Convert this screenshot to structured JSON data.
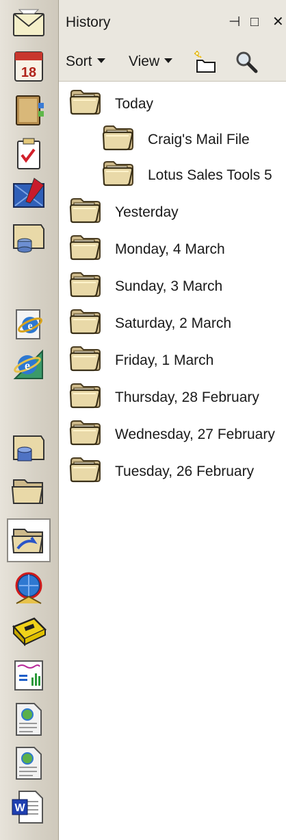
{
  "panel": {
    "title": "History",
    "controls": {
      "pin": "⊣",
      "maximize": "□",
      "close": "✕"
    }
  },
  "toolbar": {
    "sort_label": "Sort",
    "view_label": "View",
    "new_folder_icon": "new-folder-icon",
    "search_icon": "search-icon"
  },
  "tree": {
    "items": [
      {
        "label": "Today",
        "level": 0
      },
      {
        "label": "Craig's Mail File",
        "level": 1
      },
      {
        "label": "Lotus Sales Tools 5",
        "level": 1
      },
      {
        "label": "Yesterday",
        "level": 0
      },
      {
        "label": "Monday, 4 March",
        "level": 0
      },
      {
        "label": "Sunday, 3 March",
        "level": 0
      },
      {
        "label": "Saturday, 2 March",
        "level": 0
      },
      {
        "label": "Friday, 1 March",
        "level": 0
      },
      {
        "label": "Thursday, 28 February",
        "level": 0
      },
      {
        "label": "Wednesday, 27 February",
        "level": 0
      },
      {
        "label": "Tuesday, 26 February",
        "level": 0
      }
    ]
  },
  "dock": {
    "buttons": [
      {
        "name": "mail-icon"
      },
      {
        "name": "calendar-icon",
        "text": "18"
      },
      {
        "name": "address-book-icon"
      },
      {
        "name": "todo-icon"
      },
      {
        "name": "replicator-icon"
      },
      {
        "name": "databases-icon"
      },
      {
        "name": "internet-explorer-icon"
      },
      {
        "name": "internet-explorer-alt-icon"
      },
      {
        "name": "database-bookmark-icon"
      },
      {
        "name": "folder-bookmark-icon"
      },
      {
        "name": "history-icon",
        "selected": true
      },
      {
        "name": "web-globe-icon"
      },
      {
        "name": "toolbox-icon"
      },
      {
        "name": "presentation-chart-icon"
      },
      {
        "name": "web-page-icon"
      },
      {
        "name": "web-page-alt-icon"
      },
      {
        "name": "word-document-icon",
        "text": "W"
      }
    ]
  },
  "colors": {
    "dock_bg": "#d6d1c5",
    "toolbar_bg": "#eae7df",
    "folder": "#e9d9a8",
    "folder_dark": "#9c8550"
  }
}
